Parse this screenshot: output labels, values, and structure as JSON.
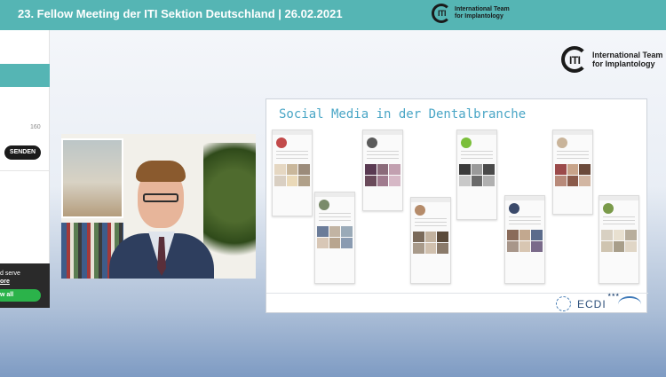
{
  "header": {
    "title": "23. Fellow Meeting der ITI Sektion Deutschland | 26.02.2021",
    "logo_mark": "ITI",
    "logo_line1": "International Team",
    "logo_line2": "for Implantology"
  },
  "chat_panel": {
    "char_count": "160",
    "send_label": "SENDEN"
  },
  "cookie_banner": {
    "text_fragment": "d serve",
    "link_fragment": "ore",
    "allow_fragment": "w all"
  },
  "presentation": {
    "logo_mark": "ITI",
    "logo_line1": "International Team",
    "logo_line2": "for Implantology",
    "slide_title": "Social Media in der Dentalbranche",
    "footer_logo_text": "ECDI"
  },
  "colors": {
    "header_bg": "#55b5b4",
    "send_button_bg": "#1b1b1b",
    "allow_button_bg": "#2bb34a",
    "slide_title": "#4aa6c6"
  },
  "icons": [
    "iti-logo-icon",
    "ecdi-globe-icon"
  ]
}
